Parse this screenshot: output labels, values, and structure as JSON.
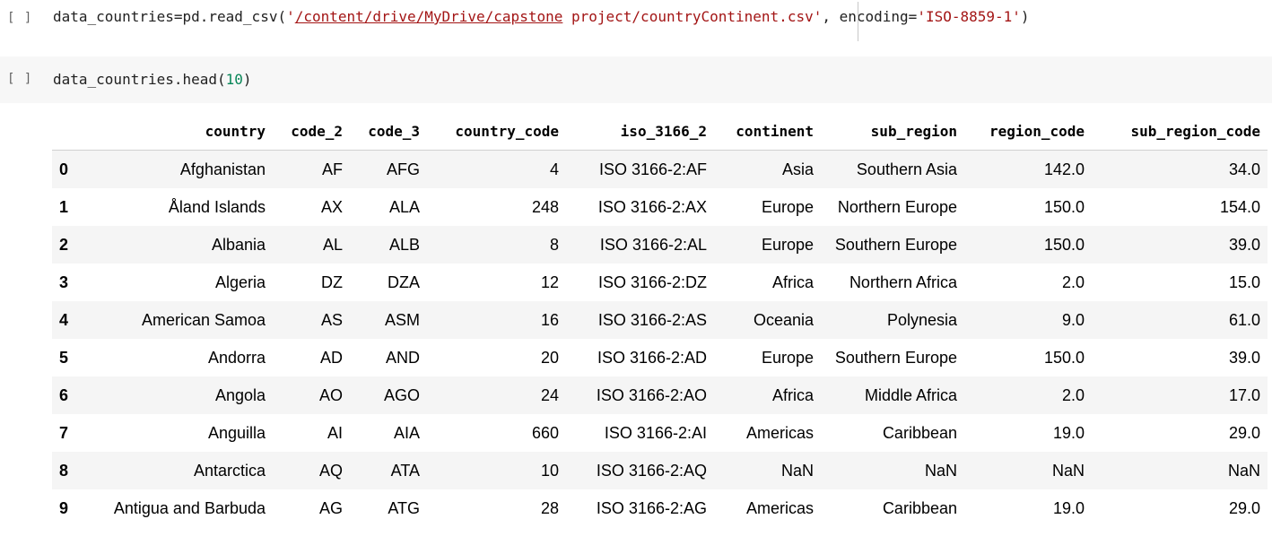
{
  "cells": {
    "cell1": {
      "indicator": "[ ]",
      "code_prefix": "data_countries=pd.read_csv(",
      "str_quote_open": "'",
      "str_link": "/content/drive/MyDrive/capstone",
      "str_rest": " project/countryContinent.csv'",
      "code_mid": ", encoding=",
      "str_encoding": "'ISO-8859-1'",
      "code_suffix": ")"
    },
    "cell2": {
      "indicator": "[ ]",
      "code_prefix": "data_countries.head(",
      "arg": "10",
      "code_suffix": ")"
    }
  },
  "table": {
    "columns": [
      "",
      "country",
      "code_2",
      "code_3",
      "country_code",
      "iso_3166_2",
      "continent",
      "sub_region",
      "region_code",
      "sub_region_code"
    ],
    "rows": [
      [
        "0",
        "Afghanistan",
        "AF",
        "AFG",
        "4",
        "ISO 3166-2:AF",
        "Asia",
        "Southern Asia",
        "142.0",
        "34.0"
      ],
      [
        "1",
        "Åland Islands",
        "AX",
        "ALA",
        "248",
        "ISO 3166-2:AX",
        "Europe",
        "Northern Europe",
        "150.0",
        "154.0"
      ],
      [
        "2",
        "Albania",
        "AL",
        "ALB",
        "8",
        "ISO 3166-2:AL",
        "Europe",
        "Southern Europe",
        "150.0",
        "39.0"
      ],
      [
        "3",
        "Algeria",
        "DZ",
        "DZA",
        "12",
        "ISO 3166-2:DZ",
        "Africa",
        "Northern Africa",
        "2.0",
        "15.0"
      ],
      [
        "4",
        "American Samoa",
        "AS",
        "ASM",
        "16",
        "ISO 3166-2:AS",
        "Oceania",
        "Polynesia",
        "9.0",
        "61.0"
      ],
      [
        "5",
        "Andorra",
        "AD",
        "AND",
        "20",
        "ISO 3166-2:AD",
        "Europe",
        "Southern Europe",
        "150.0",
        "39.0"
      ],
      [
        "6",
        "Angola",
        "AO",
        "AGO",
        "24",
        "ISO 3166-2:AO",
        "Africa",
        "Middle Africa",
        "2.0",
        "17.0"
      ],
      [
        "7",
        "Anguilla",
        "AI",
        "AIA",
        "660",
        "ISO 3166-2:AI",
        "Americas",
        "Caribbean",
        "19.0",
        "29.0"
      ],
      [
        "8",
        "Antarctica",
        "AQ",
        "ATA",
        "10",
        "ISO 3166-2:AQ",
        "NaN",
        "NaN",
        "NaN",
        "NaN"
      ],
      [
        "9",
        "Antigua and Barbuda",
        "AG",
        "ATG",
        "28",
        "ISO 3166-2:AG",
        "Americas",
        "Caribbean",
        "19.0",
        "29.0"
      ]
    ]
  },
  "colors": {
    "string": "#a31515",
    "number": "#098658",
    "stripe": "#f5f5f5"
  }
}
